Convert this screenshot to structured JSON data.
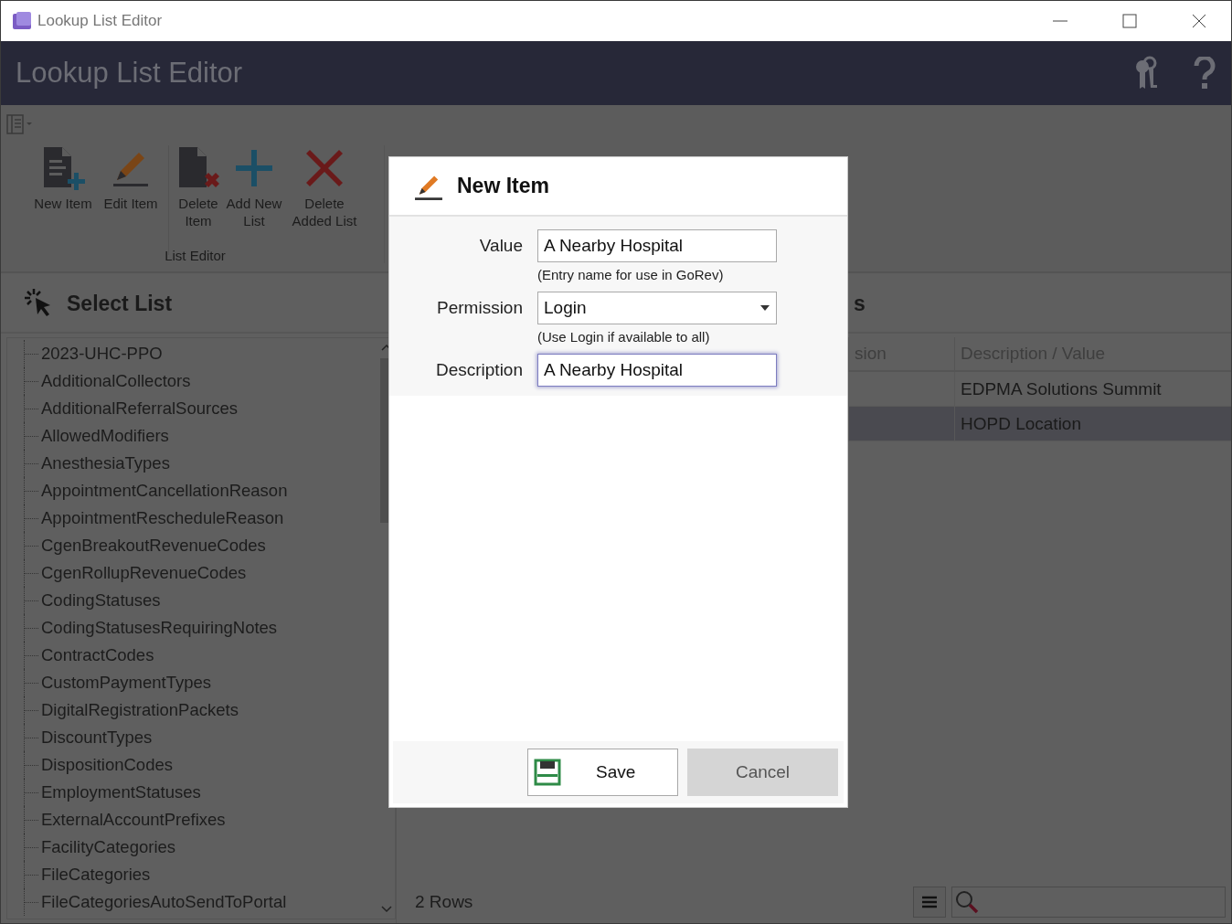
{
  "window": {
    "title": "Lookup List Editor"
  },
  "header": {
    "title": "Lookup List Editor"
  },
  "ribbon": {
    "group_label": "List Editor",
    "sections": [
      {
        "buttons": [
          "New Item",
          "Edit Item"
        ]
      },
      {
        "buttons": [
          "Delete Item",
          "Add New List",
          "Delete Added List"
        ]
      }
    ]
  },
  "select_list": {
    "title": "Select List",
    "items": [
      "2023-UHC-PPO",
      "AdditionalCollectors",
      "AdditionalReferralSources",
      "AllowedModifiers",
      "AnesthesiaTypes",
      "AppointmentCancellationReason",
      "AppointmentRescheduleReason",
      "CgenBreakoutRevenueCodes",
      "CgenRollupRevenueCodes",
      "CodingStatuses",
      "CodingStatusesRequiringNotes",
      "ContractCodes",
      "CustomPaymentTypes",
      "DigitalRegistrationPackets",
      "DiscountTypes",
      "DispositionCodes",
      "EmploymentStatuses",
      "ExternalAccountPrefixes",
      "FacilityCategories",
      "FileCategories",
      "FileCategoriesAutoSendToPortal"
    ]
  },
  "items_panel": {
    "title": "s",
    "columns": [
      "sion",
      "Description / Value"
    ],
    "rows": [
      {
        "description": "EDPMA Solutions Summit",
        "selected": false
      },
      {
        "description": "HOPD Location",
        "selected": true
      }
    ],
    "row_count": "2 Rows"
  },
  "dialog": {
    "title": "New Item",
    "fields": [
      {
        "label": "Value",
        "kind": "text",
        "value": "A Nearby Hospital",
        "hint": "(Entry name for use in GoRev)",
        "focused": false
      },
      {
        "label": "Permission",
        "kind": "dropdown",
        "value": "Login",
        "hint": "(Use Login if available to all)",
        "focused": false
      },
      {
        "label": "Description",
        "kind": "text",
        "value": "A Nearby Hospital",
        "focused": true
      }
    ],
    "buttons": [
      {
        "label": "Save",
        "kind": "save"
      },
      {
        "label": "Cancel",
        "kind": "cancel"
      }
    ]
  }
}
